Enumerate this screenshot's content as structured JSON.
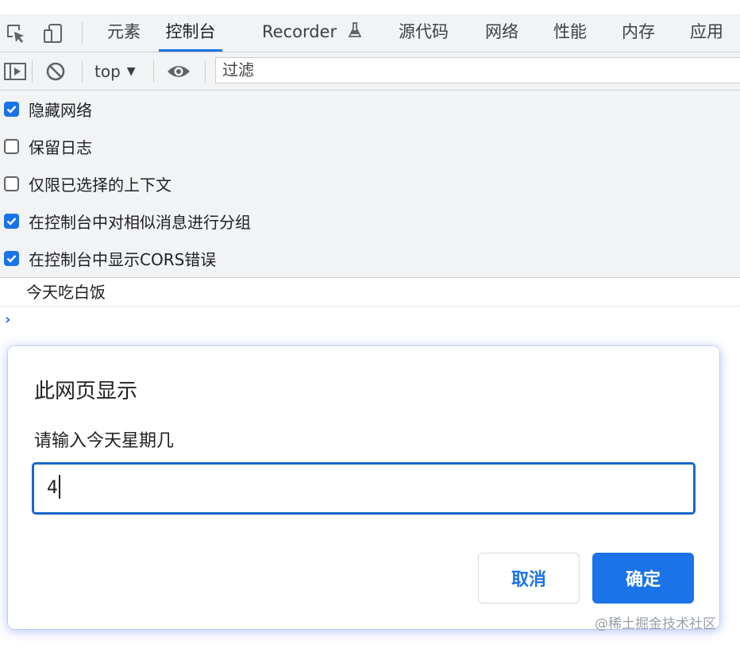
{
  "devtools": {
    "tabs": [
      {
        "label": "元素"
      },
      {
        "label": "控制台"
      },
      {
        "label": "Recorder"
      },
      {
        "label": "源代码"
      },
      {
        "label": "网络"
      },
      {
        "label": "性能"
      },
      {
        "label": "内存"
      },
      {
        "label": "应用"
      }
    ],
    "active_tab": "控制台",
    "icons": [
      "inspect-element-icon",
      "device-toolbar-icon",
      "flask-icon"
    ]
  },
  "console_toolbar": {
    "context_label": "top",
    "filter_placeholder": "过滤",
    "icons": [
      "sidebar-toggle-icon",
      "clear-console-icon",
      "dropdown-arrow-icon",
      "live-expression-eye-icon"
    ]
  },
  "settings": {
    "options": [
      {
        "label": "隐藏网络",
        "checked": true
      },
      {
        "label": "保留日志",
        "checked": false
      },
      {
        "label": "仅限已选择的上下文",
        "checked": false
      },
      {
        "label": "在控制台中对相似消息进行分组",
        "checked": true
      },
      {
        "label": "在控制台中显示CORS错误",
        "checked": true
      }
    ]
  },
  "console": {
    "log_message": "今天吃白饭",
    "prompt_icon": "chevron-right-icon"
  },
  "dialog": {
    "title": "此网页显示",
    "message": "请输入今天星期几",
    "input_value": "4",
    "cancel_label": "取消",
    "ok_label": "确定"
  },
  "watermark": "@稀土掘金技术社区",
  "colors": {
    "accent": "#1a73e8",
    "panel_bg": "#f1f3f4",
    "border": "#cbcdd1"
  }
}
